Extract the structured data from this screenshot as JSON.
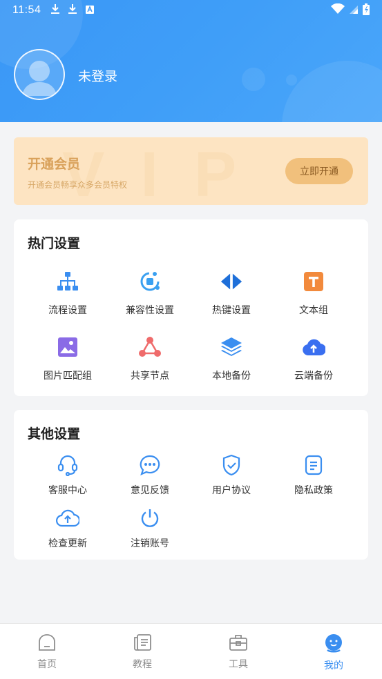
{
  "status_bar": {
    "time": "11:54",
    "left_icons": [
      "download-icon",
      "download-icon",
      "app-notification-icon"
    ],
    "right_icons": [
      "wifi-icon",
      "cellular-signal-icon",
      "battery-charging-icon"
    ]
  },
  "profile": {
    "avatar_icon": "user-avatar-icon",
    "username": "未登录"
  },
  "vip": {
    "watermark": "VIP",
    "title": "开通会员",
    "subtitle": "开通会员畅享众多会员特权",
    "button_label": "立即开通",
    "colors": {
      "background": "#fde4c2",
      "button": "#f1c07c",
      "text": "#d9a15a"
    }
  },
  "hot_settings": {
    "title": "热门设置",
    "items": [
      {
        "label": "流程设置",
        "icon": "flowchart-icon",
        "color": "#3a8ef0"
      },
      {
        "label": "兼容性设置",
        "icon": "compatibility-icon",
        "color": "#3aa0f0"
      },
      {
        "label": "热键设置",
        "icon": "hotkey-arrows-icon",
        "color": "#1e6fd9"
      },
      {
        "label": "文本组",
        "icon": "text-t-icon",
        "color": "#f28a3c"
      },
      {
        "label": "图片匹配组",
        "icon": "image-icon",
        "color": "#8a6be6"
      },
      {
        "label": "共享节点",
        "icon": "share-nodes-icon",
        "color": "#ef6b6b"
      },
      {
        "label": "本地备份",
        "icon": "layers-icon",
        "color": "#3a8ef0"
      },
      {
        "label": "云端备份",
        "icon": "cloud-upload-icon",
        "color": "#3a6ff0"
      }
    ]
  },
  "other_settings": {
    "title": "其他设置",
    "items": [
      {
        "label": "客服中心",
        "icon": "headset-icon"
      },
      {
        "label": "意见反馈",
        "icon": "feedback-chat-icon"
      },
      {
        "label": "用户协议",
        "icon": "shield-check-icon"
      },
      {
        "label": "隐私政策",
        "icon": "document-icon"
      },
      {
        "label": "检查更新",
        "icon": "cloud-upload-outline-icon"
      },
      {
        "label": "注销账号",
        "icon": "power-icon"
      }
    ],
    "icon_color": "#3a8ef0"
  },
  "bottom_nav": {
    "items": [
      {
        "label": "首页",
        "icon": "home-icon",
        "active": false
      },
      {
        "label": "教程",
        "icon": "tutorial-book-icon",
        "active": false
      },
      {
        "label": "工具",
        "icon": "toolbox-icon",
        "active": false
      },
      {
        "label": "我的",
        "icon": "profile-face-icon",
        "active": true
      }
    ],
    "active_color": "#3a8ef0"
  }
}
